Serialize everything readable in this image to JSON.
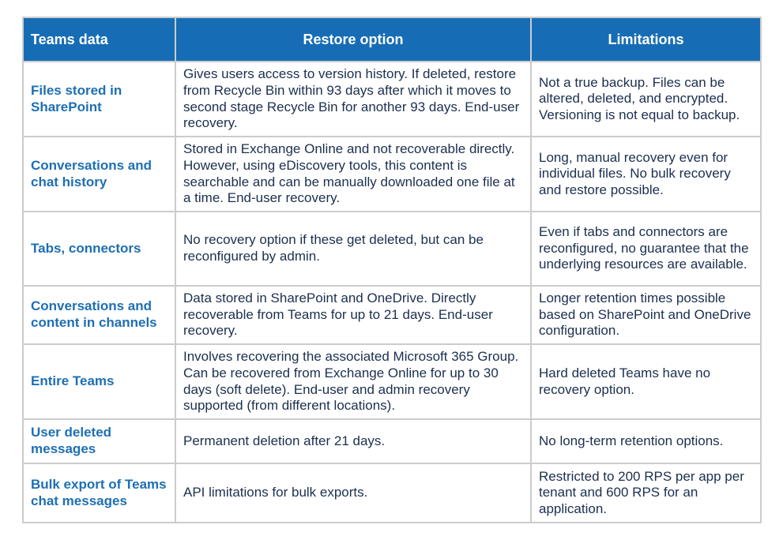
{
  "table": {
    "headers": [
      "Teams data",
      "Restore option",
      "Limitations"
    ],
    "rows": [
      {
        "teams_data": "Files stored in SharePoint",
        "restore_option": "Gives users access to version history. If deleted, restore from Recycle Bin within 93 days after which it moves to second stage Recycle Bin for another 93 days. End-user recovery.",
        "limitations": "Not a true backup. Files can be altered, deleted, and encrypted. Versioning is not equal to backup."
      },
      {
        "teams_data": "Conversations and chat history",
        "restore_option": "Stored in Exchange Online and not recoverable directly. However, using eDiscovery tools, this content is searchable and can be manually downloaded one file at a time. End-user recovery.",
        "limitations": "Long, manual recovery even for individual files. No bulk recovery and restore possible."
      },
      {
        "teams_data": "Tabs, connectors",
        "restore_option": "No recovery option if these get deleted, but can be reconfigured by admin.",
        "limitations": "Even if tabs and connectors are reconfigured, no guarantee that the underlying resources are available."
      },
      {
        "teams_data": "Conversations and content in channels",
        "restore_option": "Data stored in SharePoint and OneDrive. Directly recoverable from Teams for up to 21 days. End-user recovery.",
        "limitations": "Longer retention times possible based on SharePoint and OneDrive configuration."
      },
      {
        "teams_data": "Entire Teams",
        "restore_option": "Involves recovering the associated Microsoft 365 Group. Can be recovered from Exchange Online for up to 30 days (soft delete). End-user and admin recovery supported (from different locations).",
        "limitations": "Hard deleted Teams have no recovery option."
      },
      {
        "teams_data": "User deleted messages",
        "restore_option": "Permanent deletion after 21 days.",
        "limitations": "No long-term retention options."
      },
      {
        "teams_data": "Bulk export of Teams chat messages",
        "restore_option": "API limitations for bulk exports.",
        "limitations": "Restricted to 200 RPS per app per tenant and 600 RPS for an application."
      }
    ]
  },
  "colors": {
    "header_background": "#176db5",
    "header_text": "#ffffff",
    "key_text": "#1d6fb3",
    "body_text": "#1b2f4f",
    "border": "#cccccc"
  }
}
